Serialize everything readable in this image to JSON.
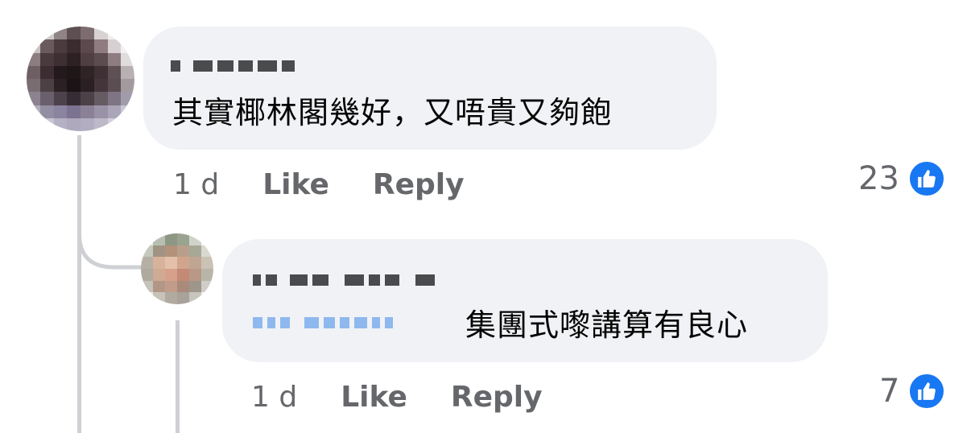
{
  "comments": [
    {
      "author": "",
      "text": "其實椰林閣幾好，又唔貴又夠飽",
      "time": "1 d",
      "like_label": "Like",
      "reply_label": "Reply",
      "reaction_count": "23",
      "reaction_icon": "thumbs-up-icon"
    }
  ],
  "reply": {
    "author": "",
    "mention": "",
    "text": "集團式嚟講算有良心",
    "time": "1 d",
    "like_label": "Like",
    "reply_label": "Reply",
    "reaction_count": "7",
    "reaction_icon": "thumbs-up-icon"
  },
  "colors": {
    "bubble": "#f0f2f5",
    "meta_text": "#65676b",
    "like_blue": "#1877f2",
    "thread_line": "#ced0d4"
  }
}
